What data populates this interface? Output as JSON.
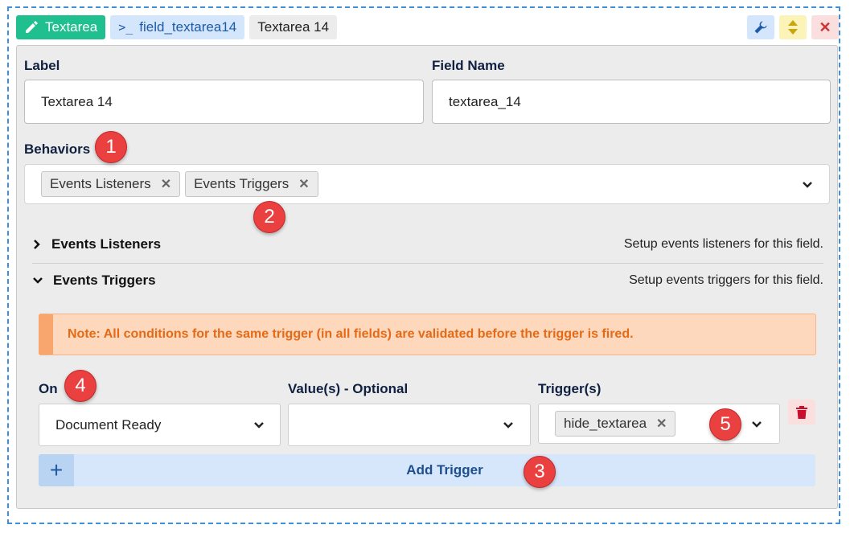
{
  "header": {
    "type_tag": "Textarea",
    "field_tag": "field_textarea14",
    "name_tag": "Textarea 14",
    "icons": [
      "pencil-icon",
      "terminal-icon",
      "wrench-icon",
      "move-icon",
      "close-icon"
    ]
  },
  "form": {
    "label_caption": "Label",
    "label_value": "Textarea 14",
    "field_name_caption": "Field Name",
    "field_name_value": "textarea_14",
    "behaviors_caption": "Behaviors",
    "behaviors": [
      "Events Listeners",
      "Events Triggers"
    ]
  },
  "sections": [
    {
      "title": "Events Listeners",
      "description": "Setup events listeners for this field.",
      "expanded": false
    },
    {
      "title": "Events Triggers",
      "description": "Setup events triggers for this field.",
      "expanded": true
    }
  ],
  "note": "Note: All conditions for the same trigger (in all fields) are validated before the trigger is fired.",
  "trigger": {
    "on_caption": "On",
    "on_value": "Document Ready",
    "values_caption": "Value(s) - Optional",
    "values_value": "",
    "triggers_caption": "Trigger(s)",
    "triggers": [
      "hide_textarea"
    ],
    "add_label": "Add Trigger"
  },
  "badges": [
    "1",
    "2",
    "3",
    "4",
    "5"
  ],
  "colors": {
    "accent": "#1fbf8f",
    "primary": "#1e5aa8",
    "warning": "#e56a16",
    "danger": "#d23232",
    "badge": "#ea4040"
  }
}
